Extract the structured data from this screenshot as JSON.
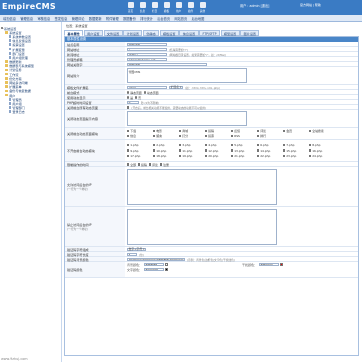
{
  "header": {
    "logo": "EmpireCMS",
    "logo_sub": "",
    "top_icons": [
      "首页",
      "信息",
      "栏目",
      "模板",
      "用户",
      "插件",
      "其他"
    ],
    "user_label": "用户：admin  [退出]",
    "right_links": "官方网站 | 帮助"
  },
  "mainnav": [
    "增加信息",
    "管理信息",
    "审核信息",
    "签发信息",
    "管理评论",
    "数据更新",
    "附件管理",
    "数据备份",
    "排行统计",
    "后台首页",
    "网站首页",
    "后台地图"
  ],
  "sidebar": {
    "items": [
      {
        "label": "系统设置",
        "type": "exp",
        "indent": 0
      },
      {
        "label": "系统设置",
        "type": "folder",
        "indent": 1
      },
      {
        "label": "系统参数设置",
        "type": "doc",
        "indent": 2
      },
      {
        "label": "信息反馈设置",
        "type": "doc",
        "indent": 2
      },
      {
        "label": "投票设置",
        "type": "doc",
        "indent": 2
      },
      {
        "label": "扩展变量",
        "type": "doc",
        "indent": 2
      },
      {
        "label": "部门设置",
        "type": "doc",
        "indent": 2
      },
      {
        "label": "用户组管理",
        "type": "doc",
        "indent": 2
      },
      {
        "label": "数据更新",
        "type": "folder",
        "indent": 1
      },
      {
        "label": "数据表与系统模型",
        "type": "folder",
        "indent": 1
      },
      {
        "label": "计划任务",
        "type": "folder",
        "indent": 1
      },
      {
        "label": "工作流",
        "type": "folder",
        "indent": 1
      },
      {
        "label": "优化方案",
        "type": "folder",
        "indent": 1
      },
      {
        "label": "网站多访问端",
        "type": "folder",
        "indent": 1
      },
      {
        "label": "扩展菜单",
        "type": "folder",
        "indent": 1
      },
      {
        "label": "备份与恢复数据",
        "type": "folder",
        "indent": 1
      },
      {
        "label": "用户",
        "type": "folder",
        "indent": 1
      },
      {
        "label": "管理员",
        "type": "doc",
        "indent": 2
      },
      {
        "label": "用户组",
        "type": "doc",
        "indent": 2
      },
      {
        "label": "管理部门",
        "type": "doc",
        "indent": 2
      },
      {
        "label": "登录日志",
        "type": "doc",
        "indent": 2
      }
    ]
  },
  "location": "位置：系统设置",
  "tabs": [
    "基本属性",
    "用户设置",
    "文件设置",
    "计划设置",
    "伪静态",
    "模板设置",
    "信息设置",
    "FTP/SFTP",
    "模型设置",
    "图片设置"
  ],
  "panel_title": "基本属性设置",
  "form": {
    "site_name_label": "站点名称",
    "site_name": "帝国CMS",
    "site_url_label": "网站地址",
    "site_url": "/",
    "site_url_hint": "(结尾需要加\"/\")",
    "news_url_label": "新闻地址",
    "news_url": "/d/file/",
    "news_url_hint": "(网站根目录设置，如果需要加\"/\"，如：/d/file/)",
    "email_label": "管理员邮箱",
    "email": "admin@phome.net",
    "keywords_label": "网站关键字",
    "keywords": "帝国CMS",
    "desc_label": "网站简介",
    "desc": "帝国CMS",
    "tpl_ext_label": "模板文件扩展名",
    "tpl_ext": ".html",
    "tpl_ext_select": "扩展名",
    "tpl_ext_hint": "(如：.html,.htm,.xml,.php)",
    "front_label": "前台模式",
    "front_opts": [
      "静态页面",
      "动态页面"
    ],
    "dyn_label": "使用动态显示",
    "dyn_opts": [
      "是",
      "否"
    ],
    "php_label": "PHP超时时间设置",
    "php_timeout": "0",
    "php_hint": "秒 (0为不限制)",
    "close_label": "关闭前台所有动态页面",
    "close_hint": "(开启后，前台相关功能不能使用，需要动态的功能不可以使用)",
    "close_reason_label": "关闭动态页面提示内容",
    "modules_label": "关闭前台动态页面模块",
    "modules": [
      "下载",
      "电影",
      "商城",
      "投稿",
      "反馈",
      "评论",
      "会员",
      "全站搜索",
      "信息",
      "留言",
      "打分",
      "投票",
      "RSS",
      "排行"
    ],
    "close_modules_label": "不开启前台动态模块",
    "close_modules": [
      "1.php",
      "2.php",
      "3.php",
      "4.php",
      "5.php",
      "6.php",
      "7.php",
      "8.php",
      "9.php",
      "10.php",
      "11.php",
      "12.php",
      "13.php",
      "14.php",
      "15.php",
      "16.php",
      "17.php",
      "18.php",
      "19.php",
      "20.php",
      "21.php",
      "22.php",
      "23.php",
      "24.php"
    ],
    "limit_label": "限制操作的时间",
    "limit_opts": [
      "全部",
      "投稿",
      "评论",
      "注册"
    ],
    "allow_ip_label": "允许访问后台的IP",
    "allow_ip_hint": "(一行为一个地址)",
    "deny_ip_label": "禁止访问后台的IP",
    "deny_ip_hint": "(一行为一个地址)",
    "verify_label": "验证码字符组成",
    "verify_select": "数字+字母",
    "verify_len_label": "验证码字符长度",
    "verify_len": "4",
    "verify_len_hint": "(位)",
    "verify_img_label": "验证码背景颜色",
    "verify_img": "#000000|#000000|#FFFFFF|#000000|#FF0000",
    "verify_img_hint": "(示例：背景色|边框色|文字色|干扰线色)",
    "verify_color_label": "验证码颜色",
    "verify_fields": [
      {
        "label": "背景颜色：",
        "value": "#FFFFFF"
      },
      {
        "label": "文字颜色：",
        "value": "#000000"
      },
      {
        "label": "干扰颜色：",
        "value": "#FF0000"
      }
    ]
  },
  "watermark": "www.9zhuj.com",
  "colors": {
    "header": "#3a7bc4",
    "nav": "#dfe9f6",
    "panel_head": "#4a86c8"
  }
}
